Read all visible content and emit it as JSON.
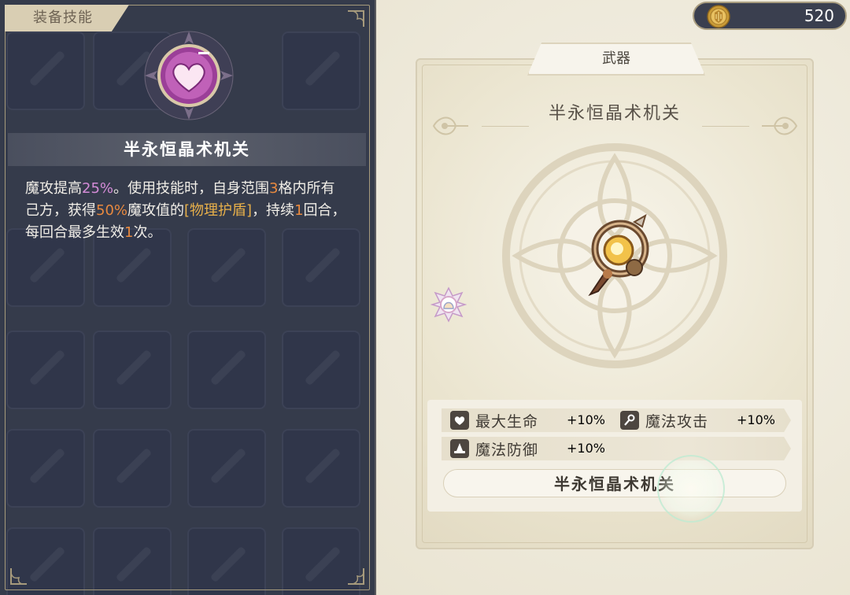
{
  "skill_panel": {
    "tab_label": "装备技能",
    "skill_name": "半永恒晶术机关",
    "description": [
      {
        "text": "魔攻提高",
        "style": "normal"
      },
      {
        "text": "25%",
        "style": "pink"
      },
      {
        "text": "。使用技能时，自身范围",
        "style": "normal"
      },
      {
        "text": "3",
        "style": "orange"
      },
      {
        "text": "格内所有己方，获得",
        "style": "normal"
      },
      {
        "text": "50%",
        "style": "orange"
      },
      {
        "text": "魔攻值的",
        "style": "normal"
      },
      {
        "text": "[物理护盾]",
        "style": "gold"
      },
      {
        "text": "，持续",
        "style": "normal"
      },
      {
        "text": "1",
        "style": "orange"
      },
      {
        "text": "回合，每回合最多生效",
        "style": "normal"
      },
      {
        "text": "1",
        "style": "orange"
      },
      {
        "text": "次。",
        "style": "normal"
      }
    ]
  },
  "currency": {
    "icon": "gold-coin-icon",
    "value": "520"
  },
  "weapon_card": {
    "tab_label": "武器",
    "title": "半永恒晶术机关",
    "stats": [
      {
        "icon": "heart-icon",
        "label": "最大生命",
        "value": "+10%"
      },
      {
        "icon": "magic-wand-icon",
        "label": "魔法攻击",
        "value": "+10%"
      },
      {
        "icon": "wizard-hat-icon",
        "label": "魔法防御",
        "value": "+10%"
      }
    ],
    "name_plate": "半永恒晶术机关"
  },
  "colors": {
    "panel_dark": "#353b4b",
    "highlight_pink": "#d48bd7",
    "highlight_orange": "#e8893f",
    "highlight_gold": "#e8b04a",
    "stat_green": "#4a9a33"
  }
}
